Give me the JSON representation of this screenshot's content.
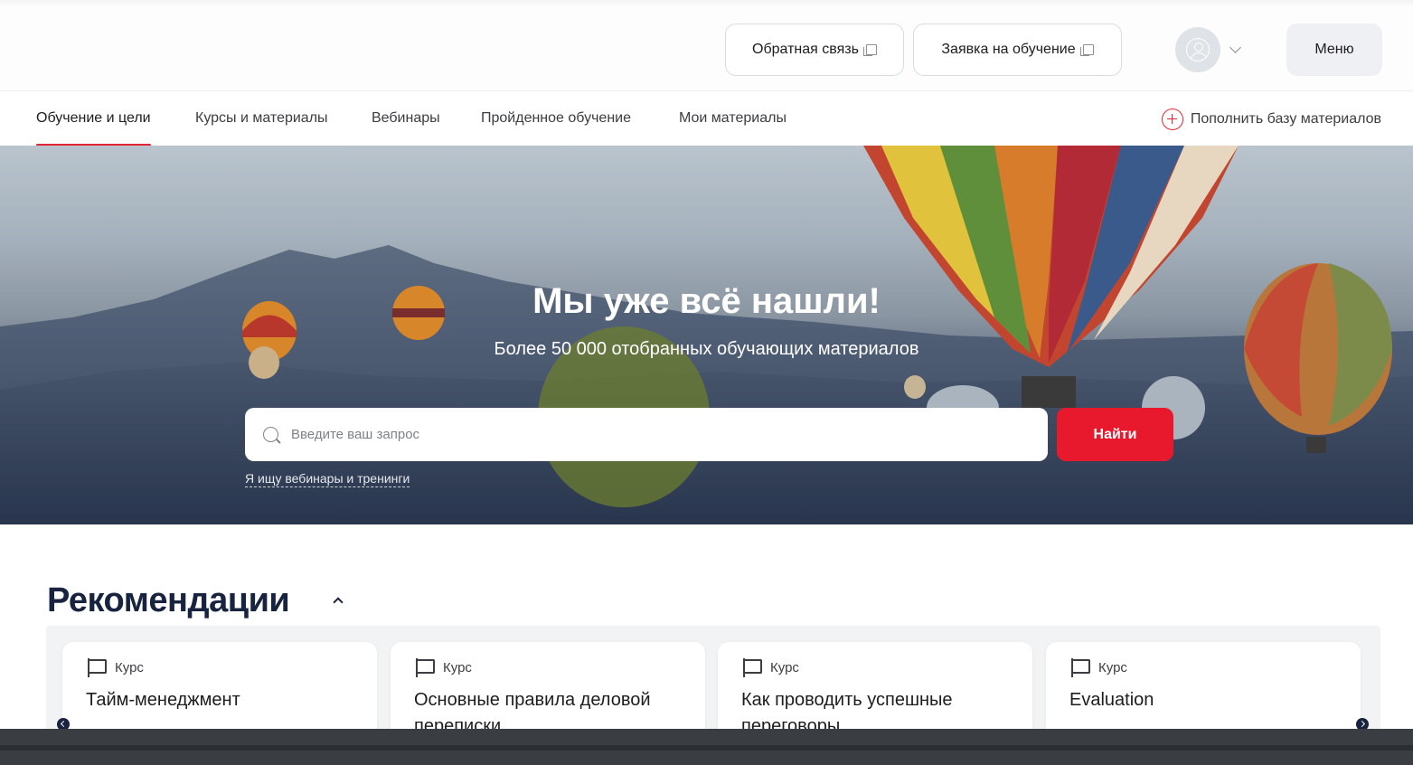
{
  "header": {
    "feedback_label": "Обратная связь",
    "request_label": "Заявка на обучение",
    "menu_label": "Меню"
  },
  "nav": {
    "items": [
      {
        "label": "Обучение и цели",
        "active": true
      },
      {
        "label": "Курсы и материалы",
        "active": false
      },
      {
        "label": "Вебинары",
        "active": false
      },
      {
        "label": "Пройденное обучение",
        "active": false
      },
      {
        "label": "Мои материалы",
        "active": false
      }
    ],
    "add_label": "Пополнить базу материалов"
  },
  "hero": {
    "title": "Мы уже всё нашли!",
    "subtitle": "Более 50 000 отобранных обучающих материалов",
    "search_placeholder": "Введите ваш запрос",
    "search_value": "",
    "find_label": "Найти",
    "hint_link": "Я ищу вебинары и тренинги"
  },
  "recommendations": {
    "title": "Рекомендации",
    "cards": [
      {
        "type": "Курс",
        "title": "Тайм-менеджмент"
      },
      {
        "type": "Курс",
        "title": "Основные правила деловой переписки"
      },
      {
        "type": "Курс",
        "title": "Как проводить успешные переговоры"
      },
      {
        "type": "Курс",
        "title": "Evaluation"
      }
    ]
  },
  "colors": {
    "accent": "#e8192c",
    "heading": "#17233f"
  }
}
